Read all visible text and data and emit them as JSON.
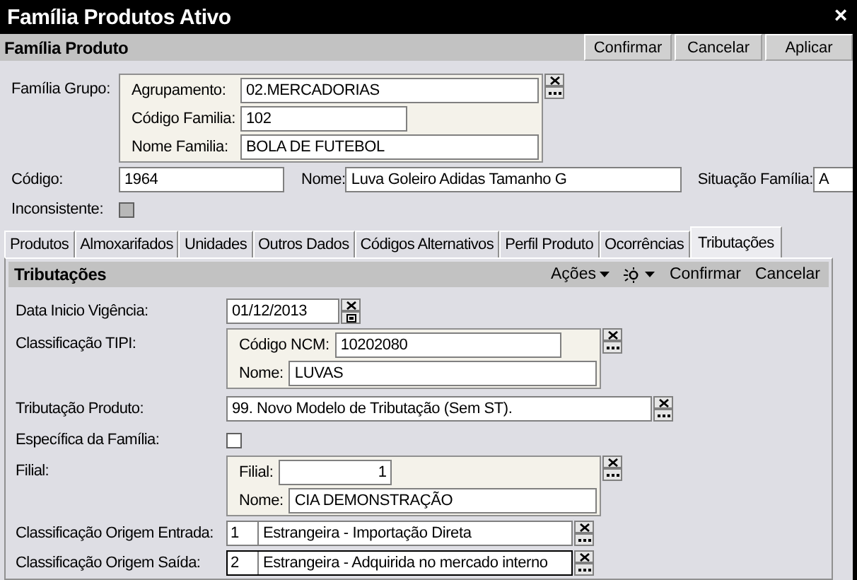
{
  "window": {
    "title": "Família Produtos Ativo",
    "close": "×"
  },
  "form": {
    "title": "Família Produto",
    "buttons": [
      "Confirmar",
      "Cancelar",
      "Aplicar"
    ]
  },
  "familia_grupo": {
    "label": "Família Grupo:",
    "fields": [
      {
        "label": "Agrupamento:",
        "value": "02.MERCADORIAS",
        "kind": "long"
      },
      {
        "label": "Código Familia:",
        "value": "102",
        "kind": "short"
      },
      {
        "label": "Nome Familia:",
        "value": "BOLA DE FUTEBOL",
        "kind": "long"
      }
    ]
  },
  "codigo": {
    "label": "Código:",
    "value": "1964"
  },
  "nome": {
    "label": "Nome:",
    "value": "Luva Goleiro Adidas Tamanho G"
  },
  "situacao": {
    "label": "Situação Família:",
    "value": "A"
  },
  "inconsistente": {
    "label": "Inconsistente:",
    "checked": false,
    "disabled": true
  },
  "tabs": [
    {
      "label": "Produtos",
      "selected": false
    },
    {
      "label": "Almoxarifados",
      "selected": false
    },
    {
      "label": "Unidades",
      "selected": false
    },
    {
      "label": "Outros Dados",
      "selected": false
    },
    {
      "label": "Códigos Alternativos",
      "selected": false
    },
    {
      "label": "Perfil Produto",
      "selected": false
    },
    {
      "label": "Ocorrências",
      "selected": false
    },
    {
      "label": "Tributações",
      "selected": true
    }
  ],
  "tributacoes": {
    "title": "Tributações",
    "toolbar": [
      {
        "kind": "menu",
        "label": "Ações"
      },
      {
        "kind": "icon-menu"
      },
      {
        "kind": "button",
        "label": "Confirmar"
      },
      {
        "kind": "button",
        "label": "Cancelar"
      }
    ],
    "rows": [
      {
        "kind": "date",
        "label": "Data Inicio Vigência:",
        "value": "01/12/2013"
      },
      {
        "kind": "group",
        "label": "Classificação TIPI:",
        "fields": [
          {
            "label": "Código NCM:",
            "value": "10202080",
            "kind": "short"
          },
          {
            "label": "Nome:",
            "value": "LUVAS",
            "kind": "long"
          }
        ]
      },
      {
        "kind": "lookup",
        "label": "Tributação Produto:",
        "value": "99. Novo Modelo de Tributação (Sem ST)."
      },
      {
        "kind": "checkbox",
        "label": "Específica da Família:",
        "checked": false
      },
      {
        "kind": "group",
        "label": "Filial:",
        "fields": [
          {
            "label": "Filial:",
            "value": "1",
            "kind": "number"
          },
          {
            "label": "Nome:",
            "value": "CIA DEMONSTRAÇÃO",
            "kind": "long"
          }
        ]
      },
      {
        "kind": "coded",
        "label": "Classificação Origem Entrada:",
        "code": "1",
        "value": "Estrangeira - Importação Direta",
        "focused": false
      },
      {
        "kind": "coded",
        "label": "Classificação Origem Saída:",
        "code": "2",
        "value": "Estrangeira - Adquirida no mercado interno",
        "focused": true
      }
    ]
  }
}
